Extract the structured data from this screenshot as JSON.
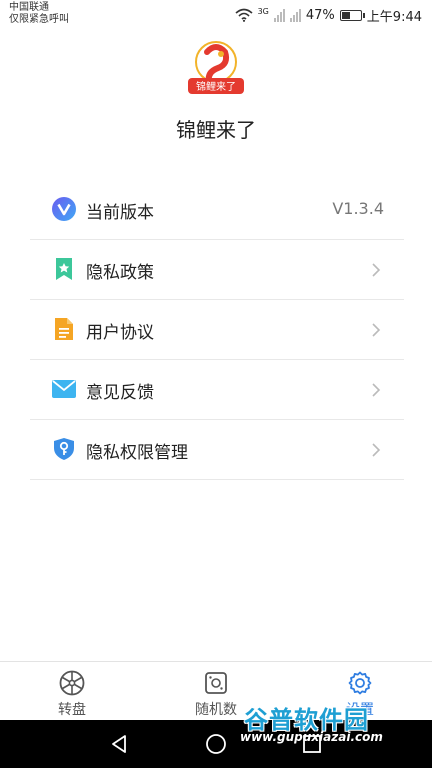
{
  "status_bar": {
    "carrier": "中国联通",
    "carrier_sub": "仅限紧急呼叫",
    "network": "3G",
    "battery": "47%",
    "battery_level": 0.47,
    "time": "上午9:44"
  },
  "app": {
    "logo_text": "锦鲤来了",
    "name": "锦鲤来了"
  },
  "menu": {
    "items": [
      {
        "label": "当前版本",
        "value": "V1.3.4",
        "icon": "v-logo-icon"
      },
      {
        "label": "隐私政策",
        "icon": "bookmark-star-icon"
      },
      {
        "label": "用户协议",
        "icon": "document-icon"
      },
      {
        "label": "意见反馈",
        "icon": "envelope-icon"
      },
      {
        "label": "隐私权限管理",
        "icon": "shield-key-icon"
      }
    ]
  },
  "bottom_nav": {
    "tabs": [
      {
        "label": "转盘",
        "icon": "wheel-icon"
      },
      {
        "label": "随机数",
        "icon": "dice-card-icon"
      },
      {
        "label": "设置",
        "icon": "gear-icon",
        "active": true
      }
    ]
  },
  "watermark": {
    "title": "谷普软件园",
    "url": "www.gupuxiazai.com"
  },
  "colors": {
    "accent": "#2f7de1",
    "logo_red": "#e43a2f",
    "logo_gold": "#f2b32a",
    "divider": "#e8e8e8"
  }
}
